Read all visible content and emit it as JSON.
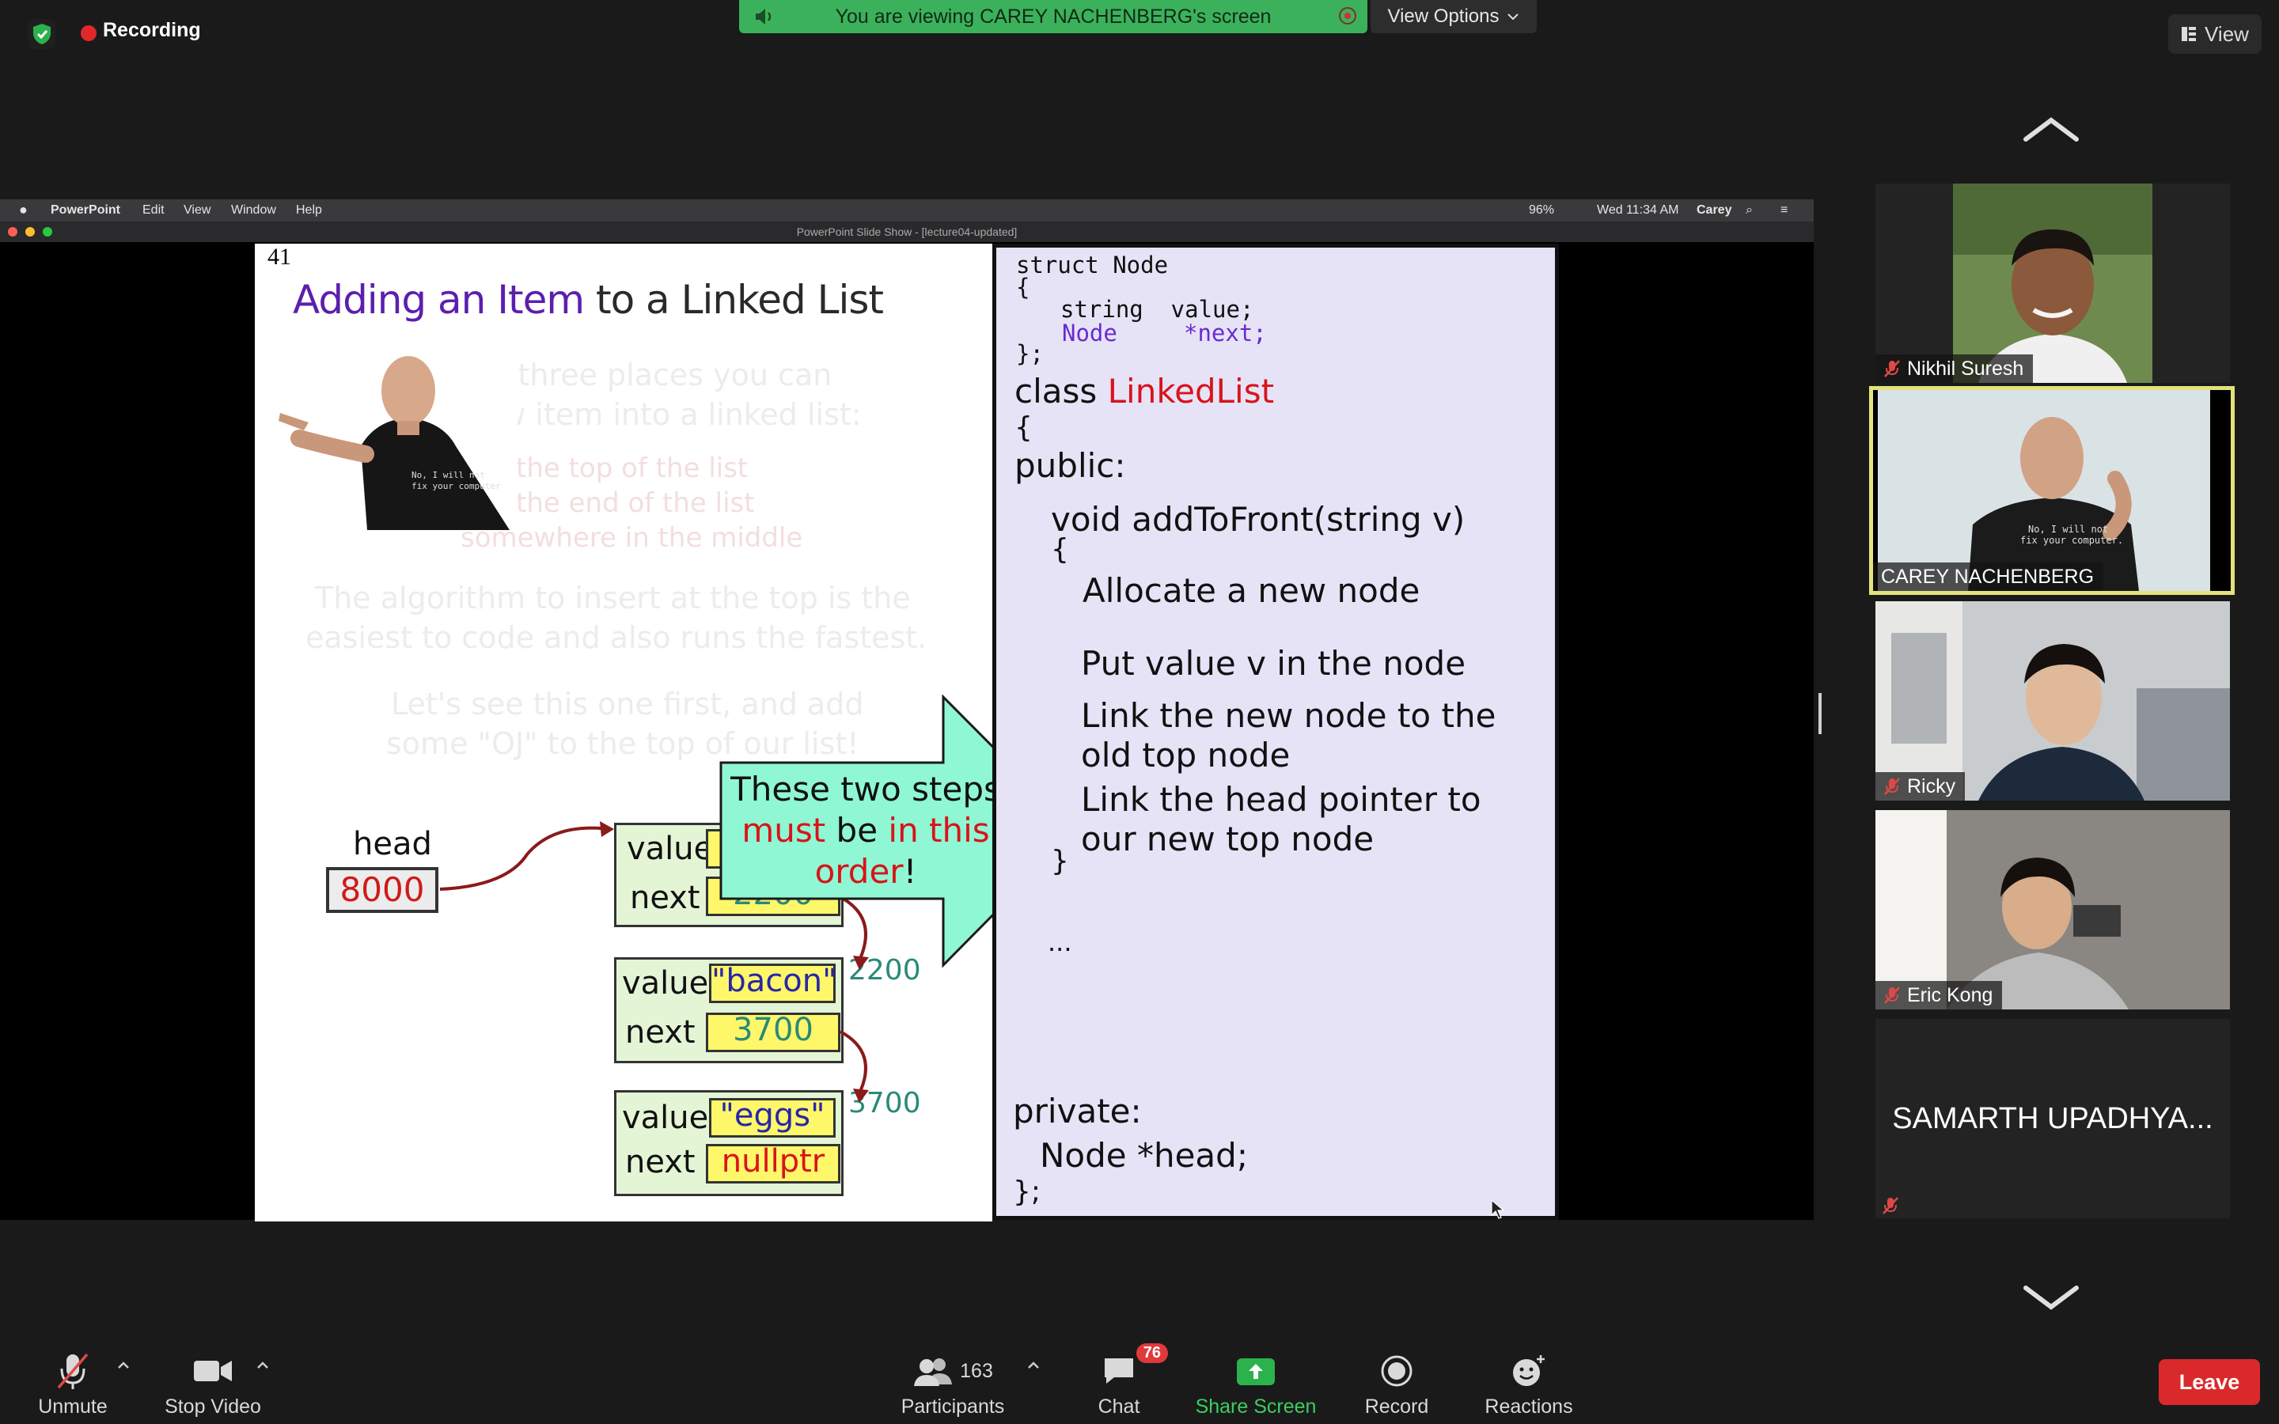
{
  "meeting": {
    "recording_label": "Recording",
    "viewing_banner": "You are viewing CAREY NACHENBERG's screen",
    "view_options_label": "View Options",
    "view_label": "View"
  },
  "shared_screen": {
    "menubar": {
      "app": "PowerPoint",
      "items": [
        "Edit",
        "View",
        "Window",
        "Help"
      ],
      "battery": "96%",
      "clock": "Wed 11:34 AM",
      "user": "Carey"
    },
    "window_title": "PowerPoint Slide Show - [lecture04-updated]",
    "slide": {
      "number": "41",
      "title_parts": [
        "Adding an ",
        "Item",
        " to a Linked List"
      ],
      "faded_lines": [
        "There are three places you can",
        "insert a new item into a linked list:",
        "the top of the list",
        "the end of the list",
        "somewhere in the middle",
        "The algorithm to insert at the top is the",
        "easiest to code and also runs the fastest.",
        "Let's see this one first, and add",
        "some \"OJ\" to the top of our list!"
      ],
      "head_label": "head",
      "head_value": "8000",
      "value_label": "value",
      "next_label": "next",
      "node1_next": "2200",
      "node2_value": "\"bacon\"",
      "node2_next": "3700",
      "node2_addr": "2200",
      "node3_value": "\"eggs\"",
      "node3_next": "nullptr",
      "node3_addr": "3700",
      "callout": {
        "line1": "These two steps",
        "must": "must",
        "be": " be ",
        "in_this": "in this",
        "order": "order",
        "bang": "!"
      },
      "code": {
        "struct_line": "struct Node",
        "brace_open": "{",
        "string_line": "string  value;",
        "node_type": "Node",
        "next_member": "*next;",
        "struct_close": "};",
        "class_kw": "class ",
        "class_name": "LinkedList",
        "class_brace": "{",
        "public": "public:",
        "method": "void addToFront(string v)",
        "method_brace": "{",
        "step1": "Allocate a new node",
        "step2": "Put value v in the node",
        "step3a": "Link the new node to the",
        "step3b": "old top node",
        "step4a": "Link the head pointer to",
        "step4b": "our new top node",
        "method_close": "}",
        "ellipsis": "...",
        "private": "private:",
        "head_member": "Node *head;",
        "class_close": "};"
      }
    }
  },
  "participants_panel": {
    "tiles": [
      {
        "name": "Nikhil Suresh",
        "muted": true
      },
      {
        "name": "CAREY NACHENBERG",
        "muted": false,
        "active_speaker": true
      },
      {
        "name": "Ricky",
        "muted": true
      },
      {
        "name": "Eric Kong",
        "muted": true
      },
      {
        "name": "SAMARTH UPADHYA...",
        "muted": true
      }
    ]
  },
  "toolbar": {
    "unmute": "Unmute",
    "stop_video": "Stop Video",
    "participants": "Participants",
    "participants_count": "163",
    "chat": "Chat",
    "chat_badge": "76",
    "share_screen": "Share Screen",
    "record": "Record",
    "reactions": "Reactions",
    "leave": "Leave"
  },
  "colors": {
    "share_green": "#3cb15b",
    "leave_red": "#d9292a",
    "active_speaker": "#e3e27b",
    "slide_purple": "#5b1fae",
    "slide_red": "#d8141a"
  }
}
